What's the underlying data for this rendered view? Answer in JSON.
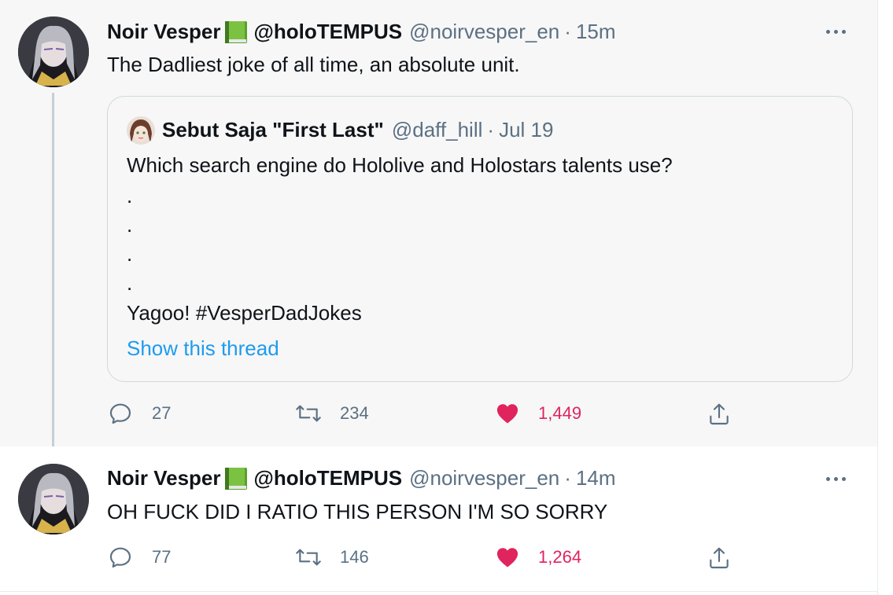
{
  "tweets": [
    {
      "display_name": "Noir Vesper",
      "secondary_name": "@holoTEMPUS",
      "handle": "@noirvesper_en",
      "separator": "·",
      "time": "15m",
      "text": "The Dadliest joke of all time, an absolute unit.",
      "quote": {
        "name": "Sebut Saja \"First Last\"",
        "handle": "@daff_hill",
        "separator": "·",
        "date": "Jul 19",
        "lines": [
          "Which search engine do Hololive and Holostars talents use?",
          ".",
          ".",
          ".",
          ".",
          "Yagoo! #VesperDadJokes"
        ],
        "link": "Show this thread"
      },
      "actions": {
        "replies": "27",
        "retweets": "234",
        "likes": "1,449"
      }
    },
    {
      "display_name": "Noir Vesper",
      "secondary_name": "@holoTEMPUS",
      "handle": "@noirvesper_en",
      "separator": "·",
      "time": "14m",
      "text": "OH FUCK DID I RATIO THIS PERSON I'M SO SORRY",
      "actions": {
        "replies": "77",
        "retweets": "146",
        "likes": "1,264"
      }
    }
  ],
  "icons": {
    "emoji": "green-book-icon",
    "more": "more-icon",
    "reply": "reply-icon",
    "retweet": "retweet-icon",
    "like": "heart-icon",
    "share": "share-icon"
  },
  "colors": {
    "like_active": "#e0245e",
    "link": "#1d9bf0",
    "secondary_text": "#5b7083",
    "highlight_bg": "#f7f7f7"
  }
}
